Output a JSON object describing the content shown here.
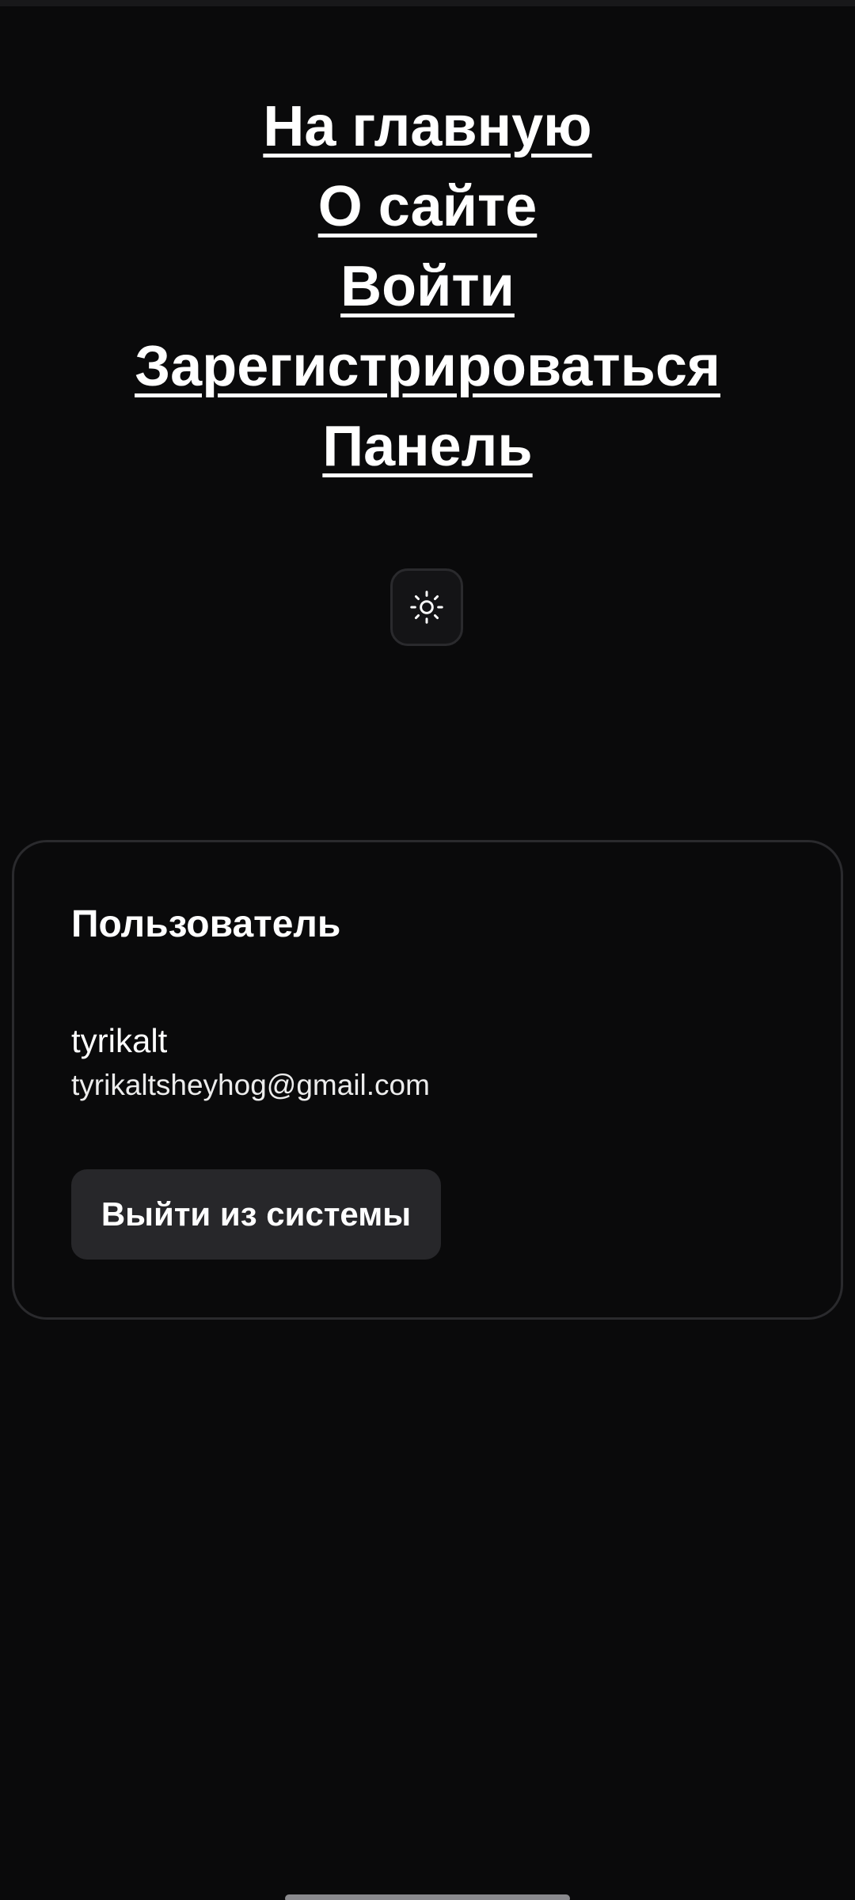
{
  "nav": {
    "items": [
      {
        "label": "На главную"
      },
      {
        "label": "О сайте"
      },
      {
        "label": "Войти"
      },
      {
        "label": "Зарегистрироваться"
      },
      {
        "label": "Панель"
      }
    ]
  },
  "theme_toggle": {
    "icon": "sun-icon"
  },
  "user_card": {
    "title": "Пользователь",
    "username": "tyrikalt",
    "email": "tyrikaltsheyhog@gmail.com",
    "logout_label": "Выйти из системы"
  },
  "colors": {
    "background": "#0a0a0b",
    "card_border": "#2a2a2d",
    "button_bg": "#27272a",
    "text": "#ffffff"
  }
}
